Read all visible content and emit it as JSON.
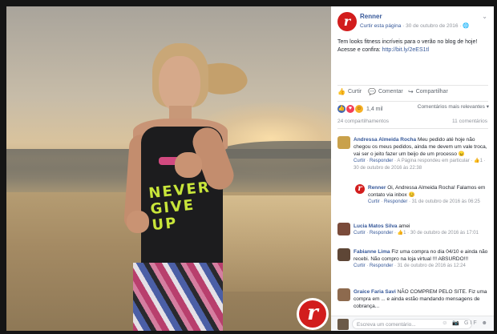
{
  "post": {
    "page_name": "Renner",
    "share_label": "Curtir esta página",
    "date": "30 de outubro de 2016",
    "globe": "🌐",
    "text": "Tem looks fitness incríveis para o verão no blog de hoje! Acesse e confira: ",
    "link": "http://bit.ly/2eES1tl",
    "avatar_letter": "r",
    "chevron": "⌄"
  },
  "photo": {
    "shirt_print": "NEVER GIVE UP",
    "logo_letter": "r"
  },
  "actions": {
    "like": "Curtir",
    "comment": "Comentar",
    "share": "Compartilhar",
    "like_icon": "👍",
    "comment_icon": "💬",
    "share_icon": "↪"
  },
  "reactions": {
    "count": "1,4 mil",
    "like_icon": "👍",
    "love_icon": "♥",
    "haha_icon": "☺"
  },
  "recent_sort": "Comentários mais relevantes ▾",
  "counts": {
    "shares": "24 compartilhamentos",
    "comments": "11 comentários"
  },
  "comments": [
    {
      "name": "Andressa Almeida Rocha",
      "text": "Meu pedido até hoje não chegou os meus pedidos, ainda me devem um vale troca, vai ser o jeito fazer um beijo de um processo",
      "emoji": "😠",
      "footer_like": "Curtir",
      "footer_reply": "Responder",
      "footer_rest": "· A Página respondeu em particular · 👍1 · 30 de outubro de 2016 às 22:38",
      "avatar_color": "#c9a14b"
    },
    {
      "name": "Renner",
      "text": "Oi, Andressa Almeida Rocha! Falamos em contato via inbox",
      "emoji": "😊",
      "footer_like": "Curtir",
      "footer_reply": "Responder",
      "footer_rest": "· 31 de outubro de 2016 às 06:25",
      "avatar_letter": "r"
    },
    {
      "name": "Lucia Matos Silva",
      "text": "amei",
      "footer_like": "Curtir",
      "footer_reply": "Responder",
      "footer_rest": "· 👍1 · 30 de outubro de 2016 às 17:01",
      "avatar_color": "#7a4b3a"
    },
    {
      "name": "Fabianne Lima",
      "text": "Fiz uma compra no dia 04/10 e ainda não recebi. Não compro na loja virtual !!! ABSURDO!!!",
      "footer_like": "Curtir",
      "footer_reply": "Responder",
      "footer_rest": "· 31 de outubro de 2016 às 12:24",
      "avatar_color": "#5e4636"
    },
    {
      "name": "Graice Faria Savi",
      "text": "NÃO COMPREM PELO SITE. Fiz uma compra em ... e ainda estão mandando mensagens de cobrança...",
      "footer_like": "",
      "footer_reply": "",
      "footer_rest": "",
      "avatar_color": "#8d6a4e"
    }
  ],
  "composer": {
    "placeholder": "Escreva um comentário...",
    "icons": "☺ 📷 GIF ☻"
  }
}
